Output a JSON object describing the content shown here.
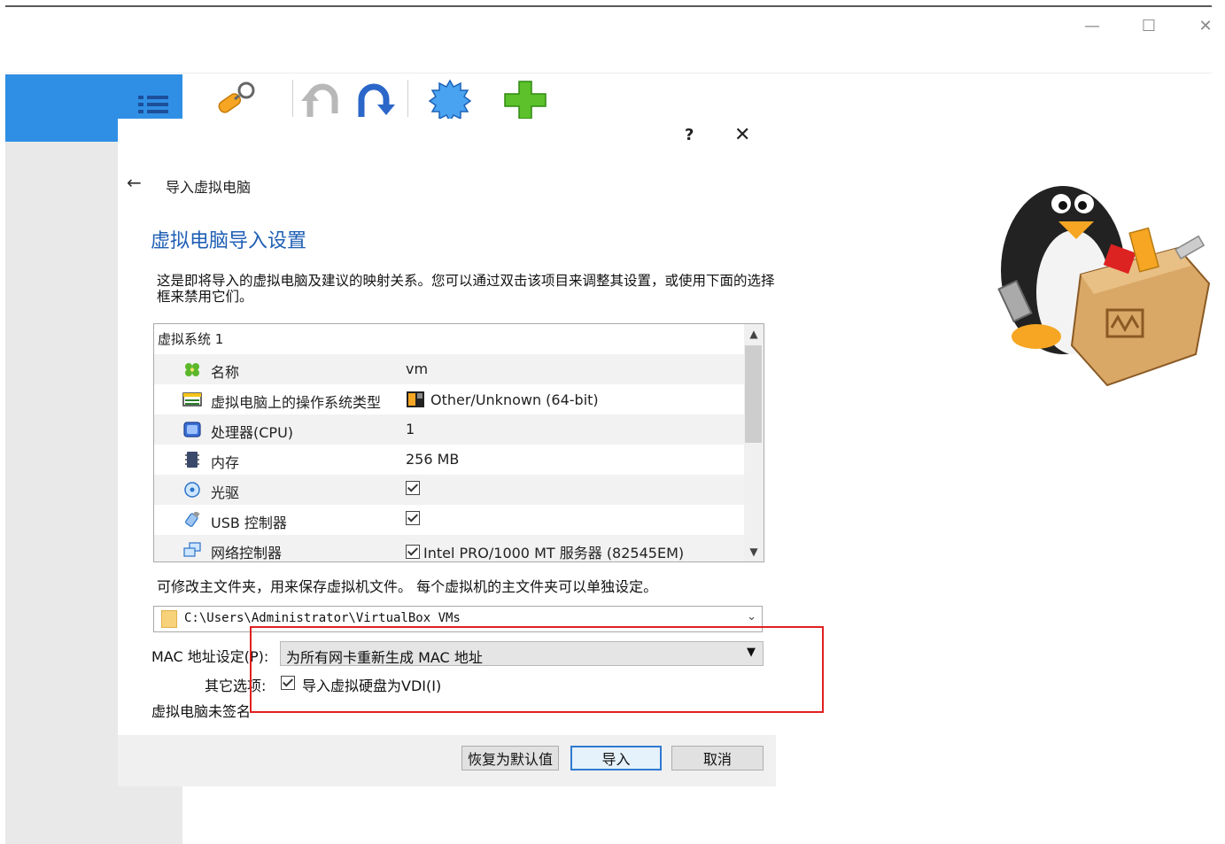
{
  "window": {
    "minimize_glyph": "—",
    "maximize_glyph": "☐",
    "close_glyph": "✕"
  },
  "toolbar": {
    "icons": [
      "list-icon",
      "wrench-icon",
      "undo-icon",
      "redo-icon",
      "gear-icon",
      "add-icon"
    ]
  },
  "dialog": {
    "help": "?",
    "close": "✕",
    "back": "←",
    "title": "导入虚拟电脑",
    "heading": "虚拟电脑导入设置",
    "description": "这是即将导入的虚拟电脑及建议的映射关系。您可以通过双击该项目来调整其设置，或使用下面的选择框来禁用它们。",
    "tree": {
      "group": "虚拟系统 1",
      "rows": [
        {
          "icon": "name-icon",
          "label": "名称",
          "value": "vm"
        },
        {
          "icon": "os-type-icon",
          "label": "虚拟电脑上的操作系统类型",
          "value": "Other/Unknown (64-bit)"
        },
        {
          "icon": "cpu-icon",
          "label": "处理器(CPU)",
          "value": "1"
        },
        {
          "icon": "memory-icon",
          "label": "内存",
          "value": "256 MB"
        },
        {
          "icon": "optical-drive-icon",
          "label": "光驱",
          "value": ""
        },
        {
          "icon": "usb-icon",
          "label": "USB 控制器",
          "value": ""
        },
        {
          "icon": "network-icon",
          "label": "网络控制器",
          "value": "Intel PRO/1000 MT 服务器 (82545EM)"
        }
      ]
    },
    "folder_note": "可修改主文件夹，用来保存虚拟机文件。 每个虚拟机的主文件夹可以单独设定。",
    "base_folder": "C:\\Users\\Administrator\\VirtualBox VMs",
    "mac_label": "MAC 地址设定(P):",
    "mac_value": "为所有网卡重新生成 MAC 地址",
    "other_label": "其它选项:",
    "vdi_label": "导入虚拟硬盘为VDI(I)",
    "unsigned": "虚拟电脑未签名",
    "buttons": {
      "restore": "恢复为默认值",
      "import": "导入",
      "cancel": "取消"
    }
  },
  "colors": {
    "accent_blue": "#2f8fe5",
    "heading_blue": "#1f5fb5",
    "annotation_red": "#e02020"
  }
}
